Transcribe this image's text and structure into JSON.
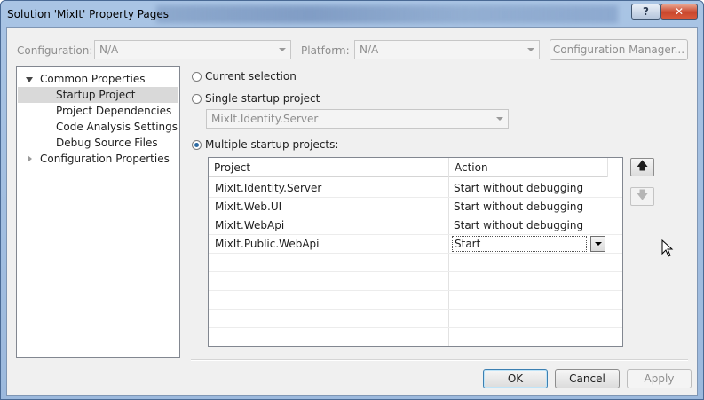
{
  "window": {
    "title": "Solution 'MixIt' Property Pages",
    "help_label": "?",
    "close_label": "✕"
  },
  "config": {
    "configuration_label": "Configuration:",
    "configuration_value": "N/A",
    "platform_label": "Platform:",
    "platform_value": "N/A",
    "manager_button": "Configuration Manager..."
  },
  "tree": {
    "items": [
      {
        "label": "Common Properties",
        "expanded": true
      },
      {
        "label": "Startup Project",
        "selected": true
      },
      {
        "label": "Project Dependencies"
      },
      {
        "label": "Code Analysis Settings"
      },
      {
        "label": "Debug Source Files"
      },
      {
        "label": "Configuration Properties",
        "expanded": false
      }
    ]
  },
  "startup": {
    "current_selection_label": "Current selection",
    "single_label": "Single startup project",
    "single_value": "MixIt.Identity.Server",
    "multiple_label": "Multiple startup projects:",
    "selected_option": "multiple"
  },
  "grid": {
    "columns": [
      "Project",
      "Action"
    ],
    "rows": [
      {
        "project": "MixIt.Identity.Server",
        "action": "Start without debugging"
      },
      {
        "project": "MixIt.Web.UI",
        "action": "Start without debugging"
      },
      {
        "project": "MixIt.WebApi",
        "action": "Start without debugging"
      },
      {
        "project": "MixIt.Public.WebApi",
        "action": "Start"
      }
    ]
  },
  "move": {
    "up_icon": "arrow-up-icon",
    "down_icon": "arrow-down-icon"
  },
  "buttons": {
    "ok": "OK",
    "cancel": "Cancel",
    "apply": "Apply"
  },
  "colors": {
    "title_bar": "#a9c4e4",
    "close_button": "#c9472d",
    "selection": "#d9d9d9"
  }
}
